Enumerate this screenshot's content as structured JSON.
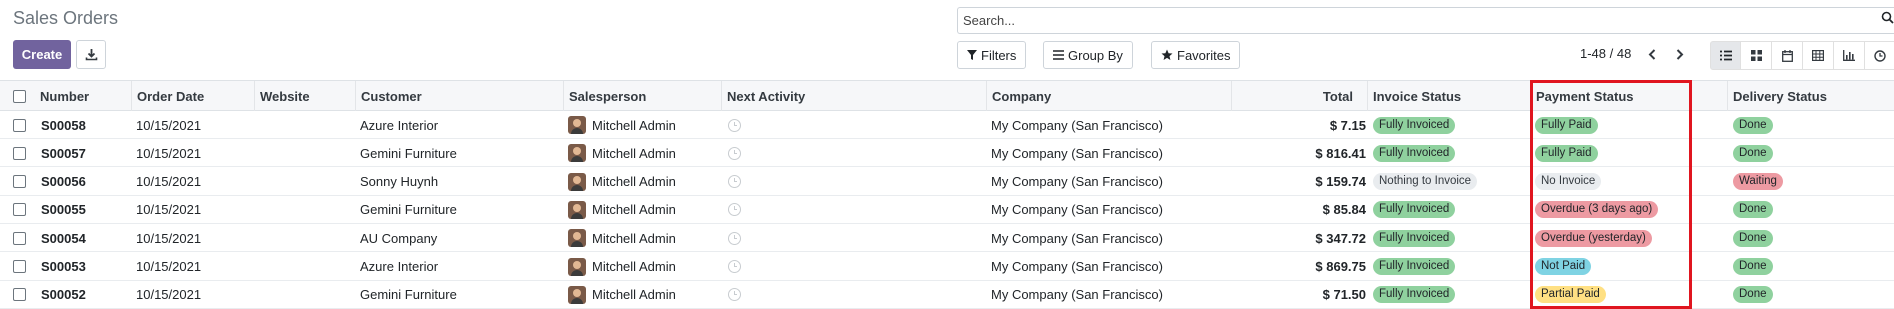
{
  "header": {
    "title": "Sales Orders",
    "create_label": "Create",
    "search_placeholder": "Search...",
    "filters_label": "Filters",
    "group_by_label": "Group By",
    "favorites_label": "Favorites",
    "pager": "1-48 / 48",
    "views": [
      "list-view-icon",
      "kanban-view-icon",
      "calendar-view-icon",
      "pivot-view-icon",
      "graph-view-icon",
      "activity-view-icon"
    ],
    "active_view": "list"
  },
  "columns": {
    "number": "Number",
    "order_date": "Order Date",
    "website": "Website",
    "customer": "Customer",
    "salesperson": "Salesperson",
    "next_activity": "Next Activity",
    "company": "Company",
    "total": "Total",
    "invoice_status": "Invoice Status",
    "payment_status": "Payment Status",
    "delivery_status": "Delivery Status"
  },
  "rows": [
    {
      "number": "S00058",
      "order_date": "10/15/2021",
      "website": "",
      "customer": "Azure Interior",
      "salesperson": "Mitchell Admin",
      "company": "My Company (San Francisco)",
      "total": "$ 7.15",
      "invoice_status": "Fully Invoiced",
      "payment_status": "Fully Paid",
      "payment_color": "green",
      "delivery_status": "Done",
      "delivery_color": "green"
    },
    {
      "number": "S00057",
      "order_date": "10/15/2021",
      "website": "",
      "customer": "Gemini Furniture",
      "salesperson": "Mitchell Admin",
      "company": "My Company (San Francisco)",
      "total": "$ 816.41",
      "invoice_status": "Fully Invoiced",
      "payment_status": "Fully Paid",
      "payment_color": "green",
      "delivery_status": "Done",
      "delivery_color": "green"
    },
    {
      "number": "S00056",
      "order_date": "10/15/2021",
      "website": "",
      "customer": "Sonny Huynh",
      "salesperson": "Mitchell Admin",
      "company": "My Company (San Francisco)",
      "total": "$ 159.74",
      "invoice_status": "Nothing to Invoice",
      "payment_status": "No Invoice",
      "payment_color": "grey",
      "delivery_status": "Waiting",
      "delivery_color": "red"
    },
    {
      "number": "S00055",
      "order_date": "10/15/2021",
      "website": "",
      "customer": "Gemini Furniture",
      "salesperson": "Mitchell Admin",
      "company": "My Company (San Francisco)",
      "total": "$ 85.84",
      "invoice_status": "Fully Invoiced",
      "payment_status": "Overdue (3 days ago)",
      "payment_color": "red",
      "delivery_status": "Done",
      "delivery_color": "green"
    },
    {
      "number": "S00054",
      "order_date": "10/15/2021",
      "website": "",
      "customer": "AU Company",
      "salesperson": "Mitchell Admin",
      "company": "My Company (San Francisco)",
      "total": "$ 347.72",
      "invoice_status": "Fully Invoiced",
      "payment_status": "Overdue (yesterday)",
      "payment_color": "red",
      "delivery_status": "Done",
      "delivery_color": "green"
    },
    {
      "number": "S00053",
      "order_date": "10/15/2021",
      "website": "",
      "customer": "Azure Interior",
      "salesperson": "Mitchell Admin",
      "company": "My Company (San Francisco)",
      "total": "$ 869.75",
      "invoice_status": "Fully Invoiced",
      "payment_status": "Not Paid",
      "payment_color": "blue",
      "delivery_status": "Done",
      "delivery_color": "green"
    },
    {
      "number": "S00052",
      "order_date": "10/15/2021",
      "website": "",
      "customer": "Gemini Furniture",
      "salesperson": "Mitchell Admin",
      "company": "My Company (San Francisco)",
      "total": "$ 71.50",
      "invoice_status": "Fully Invoiced",
      "payment_status": "Partial Paid",
      "payment_color": "yellow",
      "delivery_status": "Done",
      "delivery_color": "green"
    }
  ],
  "colors": {
    "primary": "#71639e",
    "highlight": "#e0151f"
  }
}
